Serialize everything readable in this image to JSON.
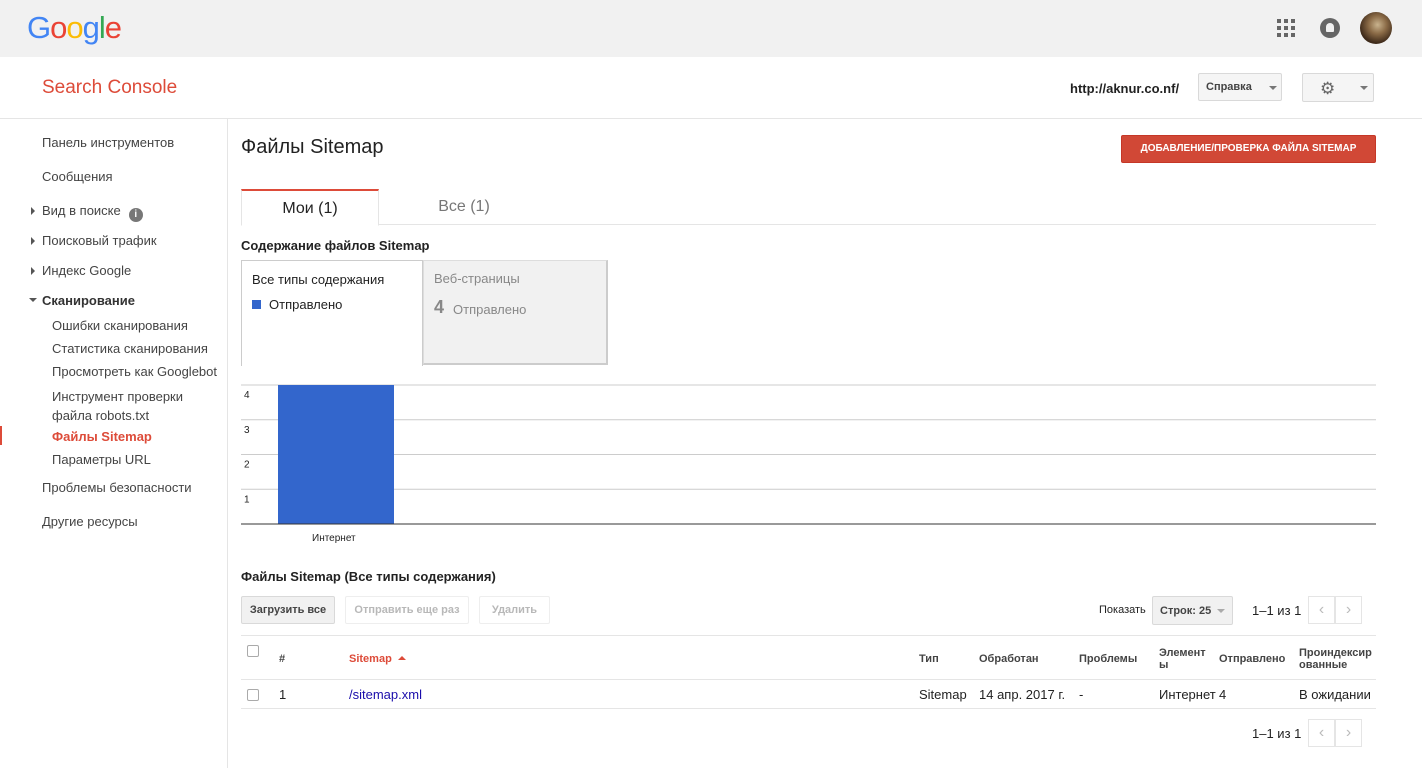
{
  "topbar": {
    "logo_letters": [
      {
        "ch": "G",
        "color": "#4285f4"
      },
      {
        "ch": "o",
        "color": "#ea4335"
      },
      {
        "ch": "o",
        "color": "#fbbc05"
      },
      {
        "ch": "g",
        "color": "#4285f4"
      },
      {
        "ch": "l",
        "color": "#34a853"
      },
      {
        "ch": "e",
        "color": "#ea4335"
      }
    ]
  },
  "header": {
    "product_name": "Search Console",
    "site_url": "http://aknur.co.nf/",
    "help_label": "Справка"
  },
  "sidebar": {
    "dashboard": "Панель инструментов",
    "messages": "Сообщения",
    "search_appearance": "Вид в поиске",
    "search_traffic": "Поисковый трафик",
    "google_index": "Индекс Google",
    "crawl": "Сканирование",
    "crawl_errors": "Ошибки сканирования",
    "crawl_stats": "Статистика сканирования",
    "fetch_as_googlebot": "Просмотреть как Googlebot",
    "robots_tester_line1": "Инструмент проверки",
    "robots_tester_line2": "файла robots.txt",
    "sitemaps": "Файлы Sitemap",
    "url_params": "Параметры URL",
    "security_issues": "Проблемы безопасности",
    "other_resources": "Другие ресурсы"
  },
  "main": {
    "title": "Файлы Sitemap",
    "add_button": "ДОБАВЛЕНИЕ/ПРОВЕРКА ФАЙЛА SITEMAP",
    "tabs": [
      {
        "label": "Мои (1)",
        "active": true
      },
      {
        "label": "Все (1)",
        "active": false
      }
    ],
    "content_title": "Содержание файлов Sitemap",
    "content_types": [
      {
        "label": "Все типы содержания",
        "legend": "Отправлено"
      },
      {
        "label": "Веб-страницы",
        "count": "4",
        "legend": "Отправлено"
      }
    ],
    "list_title": "Файлы Sitemap (Все типы содержания)",
    "buttons": {
      "resubmit_all": "Загрузить все",
      "resubmit": "Отправить еще раз",
      "delete": "Удалить"
    },
    "pager": {
      "show_label": "Показать",
      "rows_label": "Строк: 25",
      "range": "1–1 из 1"
    },
    "table": {
      "headers": {
        "num": "#",
        "sitemap": "Sitemap",
        "type": "Тип",
        "processed": "Обработан",
        "issues": "Проблемы",
        "items_line1": "Элемент",
        "items_line2": "ы",
        "submitted": "Отправлено",
        "indexed_line1": "Проиндексир",
        "indexed_line2": "ованные"
      },
      "rows": [
        {
          "num": "1",
          "sitemap": "/sitemap.xml",
          "type": "Sitemap",
          "processed": "14 апр. 2017 г.",
          "issues": "-",
          "items": "Интернет",
          "submitted": "4",
          "indexed": "В ожидании"
        }
      ]
    }
  },
  "chart_data": {
    "type": "bar",
    "categories": [
      "Интернет"
    ],
    "series": [
      {
        "values": [
          4
        ]
      }
    ],
    "y_ticks": [
      1,
      2,
      3,
      4
    ],
    "ylim": [
      0,
      4
    ],
    "color": "#3366cc",
    "grid": true
  }
}
